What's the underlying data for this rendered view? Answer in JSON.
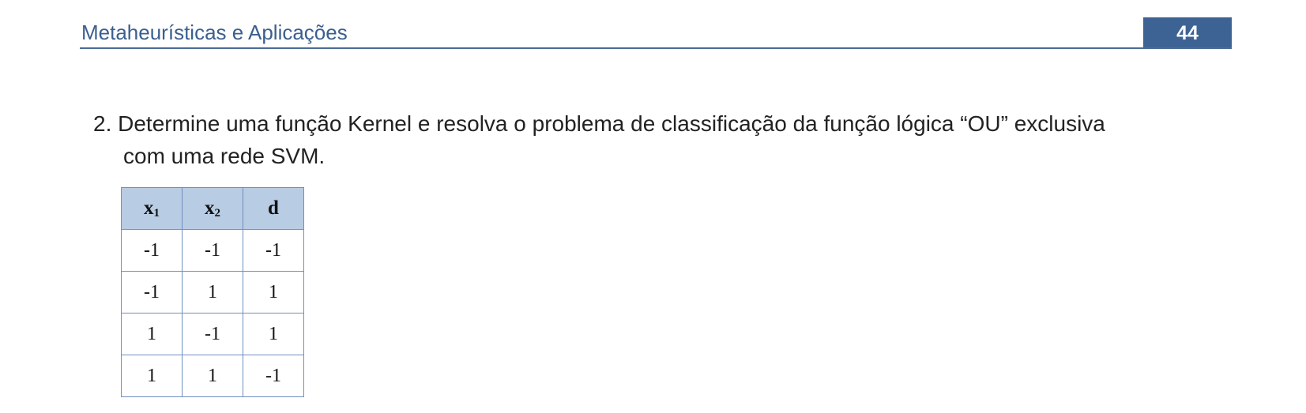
{
  "header": {
    "title": "Metaheurísticas e Aplicações",
    "page_number": "44"
  },
  "question": {
    "line1": "2. Determine uma função Kernel e resolva o problema de classificação da função lógica “OU” exclusiva",
    "line2": "com uma rede SVM."
  },
  "table": {
    "headers": [
      {
        "base": "x",
        "sub": "1"
      },
      {
        "base": "x",
        "sub": "2"
      },
      {
        "base": "d",
        "sub": ""
      }
    ],
    "rows": [
      [
        "-1",
        "-1",
        "-1"
      ],
      [
        "-1",
        "1",
        "1"
      ],
      [
        "1",
        "-1",
        "1"
      ],
      [
        "1",
        "1",
        "-1"
      ]
    ]
  },
  "colors": {
    "header_text": "#3b5f8f",
    "page_box": "#3d6394",
    "table_header_bg": "#b8cce4",
    "table_border": "#6e8fc2"
  }
}
